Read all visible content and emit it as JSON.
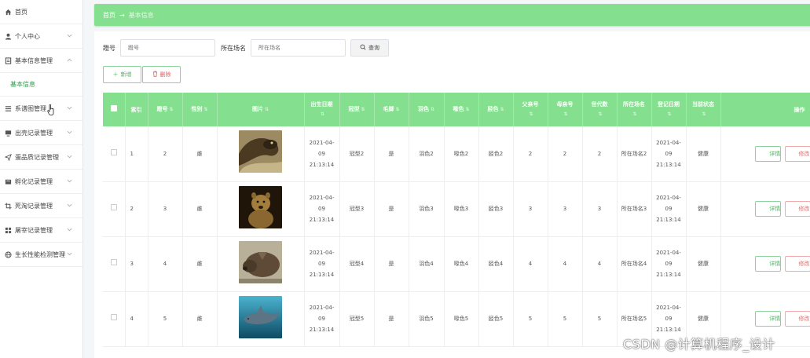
{
  "sidebar": {
    "items": [
      {
        "label": "首页",
        "icon": "home-icon",
        "glyph": "⌂",
        "chevron": false
      },
      {
        "label": "个人中心",
        "icon": "user-icon",
        "glyph": "●",
        "chevron": true
      },
      {
        "label": "基本信息管理",
        "icon": "document-icon",
        "glyph": "▤",
        "chevron": true,
        "expanded": true
      },
      {
        "label": "系谱图管理",
        "icon": "menu-icon",
        "glyph": "≡",
        "chevron": true
      },
      {
        "label": "出壳记录管理",
        "icon": "monitor-icon",
        "glyph": "▭",
        "chevron": true
      },
      {
        "label": "蛋品质记录管理",
        "icon": "send-icon",
        "glyph": "➤",
        "chevron": true
      },
      {
        "label": "孵化记录管理",
        "icon": "folder-icon",
        "glyph": "▣",
        "chevron": true
      },
      {
        "label": "死淘记录管理",
        "icon": "crop-icon",
        "glyph": "⌗",
        "chevron": true
      },
      {
        "label": "屠宰记录管理",
        "icon": "grid-icon",
        "glyph": "▦",
        "chevron": true
      },
      {
        "label": "生长性能检测管理",
        "icon": "globe-icon",
        "glyph": "◍",
        "chevron": true
      }
    ],
    "submenu_label": "基本信息"
  },
  "breadcrumb": {
    "home": "首页",
    "separator": "→",
    "current": "基本信息"
  },
  "search": {
    "field1_label": "蹬号",
    "field1_placeholder": "蹬号",
    "field2_label": "所在场名",
    "field2_placeholder": "所在场名",
    "button_label": "查询"
  },
  "actions": {
    "add_label": "新增",
    "delete_label": "删除"
  },
  "table": {
    "headers": [
      "索引",
      "蹬号",
      "性别",
      "图片",
      "出生日期",
      "冠型",
      "毛脚",
      "羽色",
      "喙色",
      "胫色",
      "父亲号",
      "母亲号",
      "世代数",
      "所在场名",
      "登记日期",
      "当前状态",
      "操作"
    ],
    "rows": [
      {
        "index": "1",
        "id": "2",
        "gender": "雌",
        "birth": "2021-04-09 21:13:14",
        "comb": "冠型2",
        "feet": "是",
        "feather": "羽色2",
        "beak": "喙色2",
        "shank": "胫色2",
        "father": "2",
        "mother": "2",
        "generation": "2",
        "farm": "所在场名2",
        "reg": "2021-04-09 21:13:14",
        "status": "健康",
        "img_color": "#6b5a3a"
      },
      {
        "index": "2",
        "id": "3",
        "gender": "雌",
        "birth": "2021-04-09 21:13:14",
        "comb": "冠型3",
        "feet": "是",
        "feather": "羽色3",
        "beak": "喙色3",
        "shank": "胫色3",
        "father": "3",
        "mother": "3",
        "generation": "3",
        "farm": "所在场名3",
        "reg": "2021-04-09 21:13:14",
        "status": "健康",
        "img_color": "#3a2a14"
      },
      {
        "index": "3",
        "id": "4",
        "gender": "雌",
        "birth": "2021-04-09 21:13:14",
        "comb": "冠型4",
        "feet": "是",
        "feather": "羽色4",
        "beak": "喙色4",
        "shank": "胫色4",
        "father": "4",
        "mother": "4",
        "generation": "4",
        "farm": "所在场名4",
        "reg": "2021-04-09 21:13:14",
        "status": "健康",
        "img_color": "#7a6a55"
      },
      {
        "index": "4",
        "id": "5",
        "gender": "雌",
        "birth": "2021-04-09 21:13:14",
        "comb": "冠型5",
        "feet": "是",
        "feather": "羽色5",
        "beak": "喙色5",
        "shank": "胫色5",
        "father": "5",
        "mother": "5",
        "generation": "5",
        "farm": "所在场名5",
        "reg": "2021-04-09 21:13:14",
        "status": "健康",
        "img_color": "#2b6f86"
      }
    ],
    "view_label": "详情",
    "edit_label": "修改"
  },
  "watermark": "CSDN @计算机程序_设计",
  "colors": {
    "accent": "#84df8e",
    "accent_text": "#48b45e",
    "danger": "#e86a6a"
  }
}
